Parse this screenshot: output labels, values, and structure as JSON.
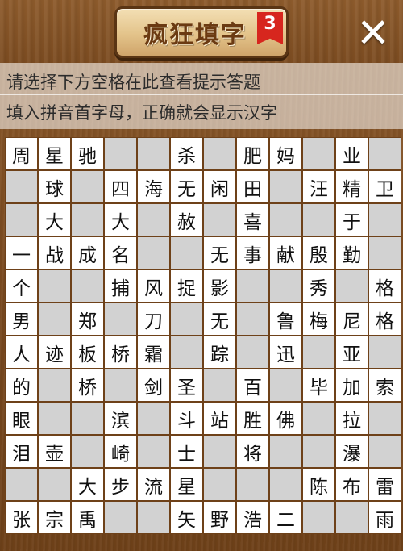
{
  "header": {
    "title": "疯狂填字",
    "level_badge": "3",
    "close_icon": "close-icon"
  },
  "hint": {
    "line1": "请选择下方空格在此查看提示答题",
    "line2": "填入拼音首字母，正确就会显示汉字"
  },
  "board": {
    "rows": [
      [
        "周",
        "星",
        "驰",
        "",
        "",
        "杀",
        "",
        "肥",
        "妈",
        "",
        "业",
        ""
      ],
      [
        "",
        "球",
        "",
        "四",
        "海",
        "无",
        "闲",
        "田",
        "",
        "汪",
        "精",
        "卫"
      ],
      [
        "",
        "大",
        "",
        "大",
        "",
        "赦",
        "",
        "喜",
        "",
        "",
        "于",
        ""
      ],
      [
        "一",
        "战",
        "成",
        "名",
        "",
        "",
        "无",
        "事",
        "献",
        "殷",
        "勤",
        ""
      ],
      [
        "个",
        "",
        "",
        "捕",
        "风",
        "捉",
        "影",
        "",
        "",
        "秀",
        "",
        "格"
      ],
      [
        "男",
        "",
        "郑",
        "",
        "刀",
        "",
        "无",
        "",
        "鲁",
        "梅",
        "尼",
        "格"
      ],
      [
        "人",
        "迹",
        "板",
        "桥",
        "霜",
        "",
        "踪",
        "",
        "迅",
        "",
        "亚",
        ""
      ],
      [
        "的",
        "",
        "桥",
        "",
        "剑",
        "圣",
        "",
        "百",
        "",
        "毕",
        "加",
        "索"
      ],
      [
        "眼",
        "",
        "",
        "滨",
        "",
        "斗",
        "站",
        "胜",
        "佛",
        "",
        "拉",
        ""
      ],
      [
        "泪",
        "壶",
        "",
        "崎",
        "",
        "士",
        "",
        "将",
        "",
        "",
        "瀑",
        ""
      ],
      [
        "",
        "",
        "大",
        "步",
        "流",
        "星",
        "",
        "",
        "",
        "陈",
        "布",
        "雷"
      ],
      [
        "张",
        "宗",
        "禹",
        "",
        "",
        "矢",
        "野",
        "浩",
        "二",
        "",
        "",
        "雨"
      ]
    ]
  }
}
